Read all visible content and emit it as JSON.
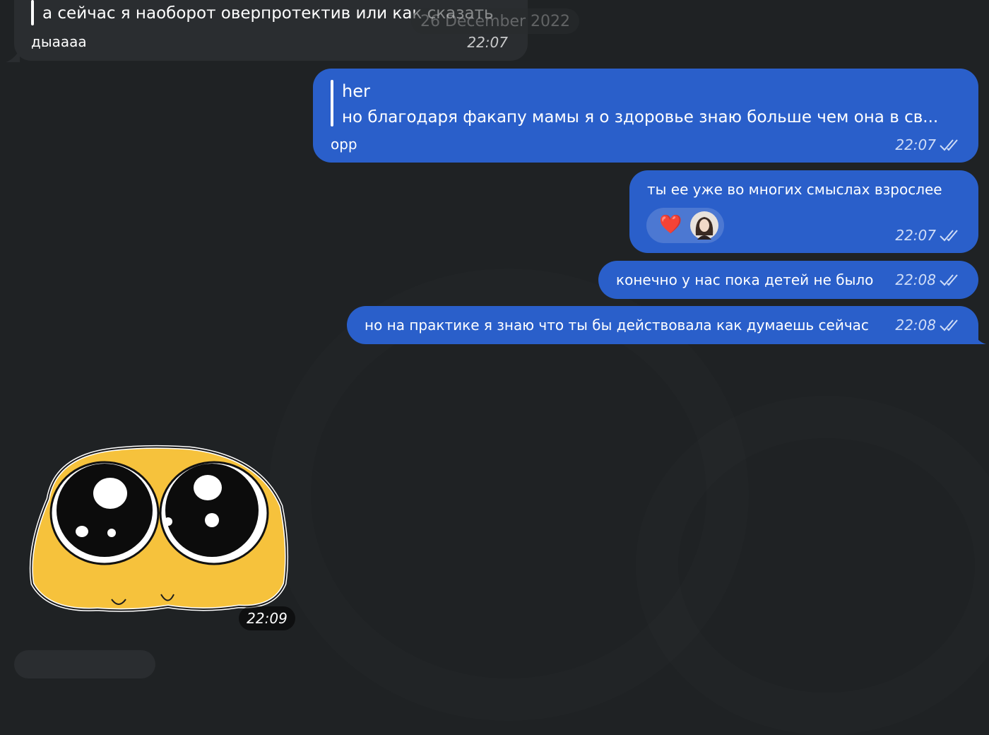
{
  "date_badge": "26 December 2022",
  "messages": {
    "m0": {
      "quote_text": "а сейчас я наоборот оверпротектив или как сказать",
      "text": "дыаааа",
      "time": "22:07"
    },
    "m1": {
      "quote_author": "her",
      "quote_text": "но благодаря факапу мамы я о здоровье знаю больше чем она в св...",
      "text": "орр",
      "time": "22:07"
    },
    "m2": {
      "text": "ты ее уже во многих смыслах взрослее",
      "reaction_emoji": "❤️",
      "reaction_avatar": "avatar-icon",
      "time": "22:07"
    },
    "m3": {
      "text": "конечно у нас пока детей не было",
      "time": "22:08"
    },
    "m4": {
      "text": "но на практике я знаю что ты бы действовала как думаешь сейчас",
      "time": "22:08"
    },
    "m5": {
      "sticker": "pleading-face-sticker",
      "time": "22:09"
    }
  },
  "colors": {
    "background": "#1f2224",
    "incoming": "#2a2d30",
    "outgoing": "#2a5fca"
  }
}
